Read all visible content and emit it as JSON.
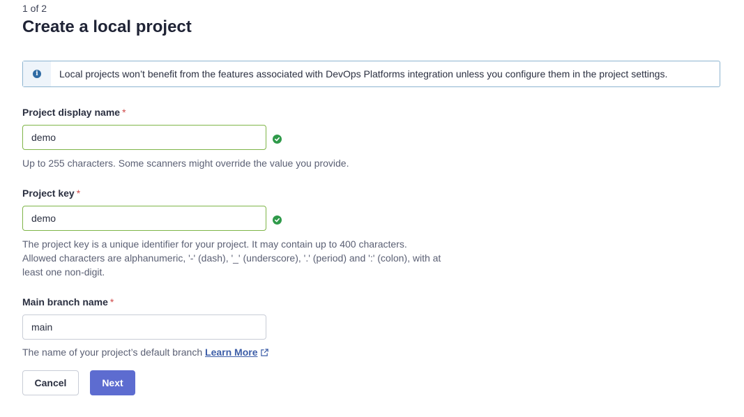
{
  "header": {
    "step": "1 of 2",
    "title": "Create a local project"
  },
  "banner": {
    "icon": "info-icon",
    "text": "Local projects won’t benefit from the features associated with DevOps Platforms integration unless you configure them in the project settings."
  },
  "fields": {
    "display_name": {
      "label": "Project display name",
      "required_mark": "*",
      "value": "demo",
      "status": "valid",
      "help": "Up to 255 characters. Some scanners might override the value you provide."
    },
    "project_key": {
      "label": "Project key",
      "required_mark": "*",
      "value": "demo",
      "status": "valid",
      "help_line1": "The project key is a unique identifier for your project. It may contain up to 400 characters.",
      "help_line2": "Allowed characters are alphanumeric, '-' (dash), '_' (underscore), '.' (period) and ':' (colon), with at",
      "help_line3": "least one non-digit."
    },
    "main_branch": {
      "label": "Main branch name",
      "required_mark": "*",
      "value": "main",
      "help": "The name of your project’s default branch",
      "link": "Learn More"
    }
  },
  "actions": {
    "cancel": "Cancel",
    "next": "Next"
  },
  "colors": {
    "primary": "#5d6cd0",
    "valid": "#2f9a4a",
    "required": "#d04a4a",
    "link": "#3d5ea8"
  }
}
